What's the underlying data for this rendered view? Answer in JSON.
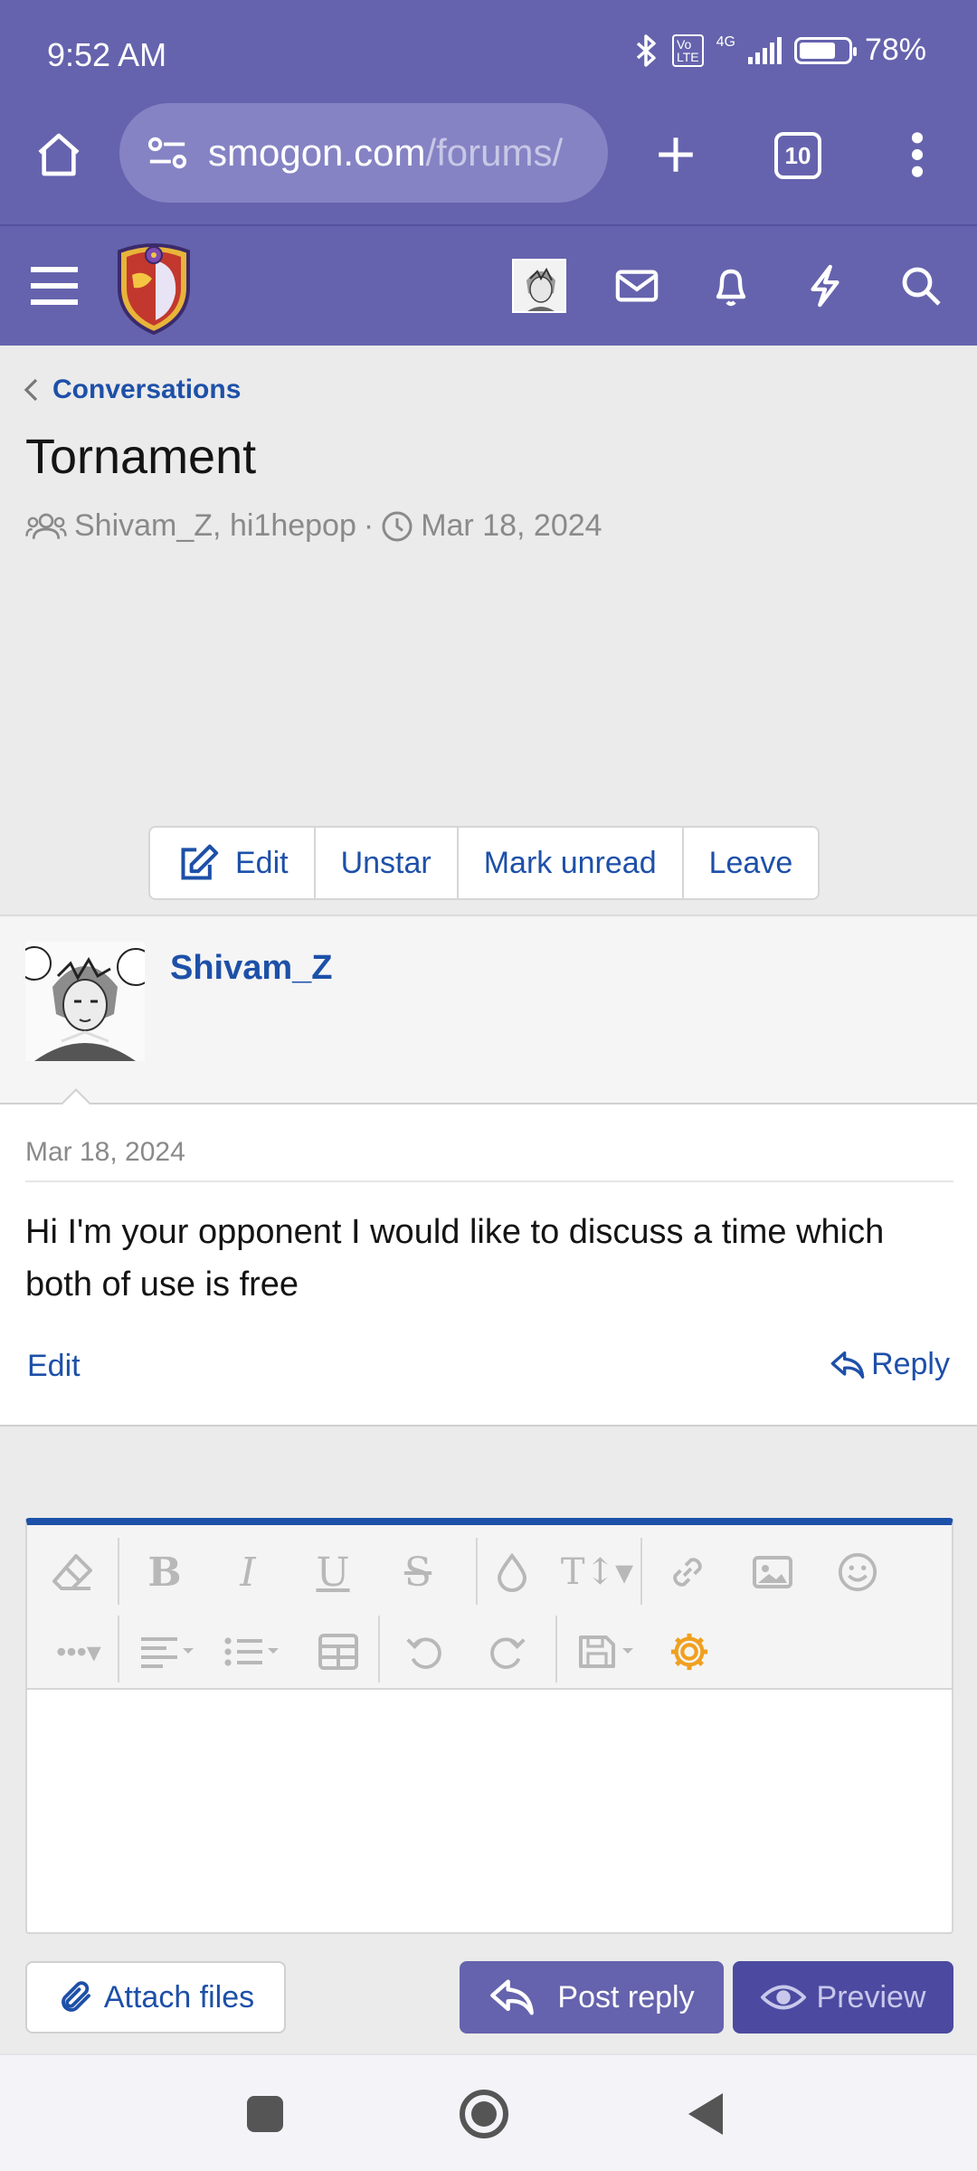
{
  "status_bar": {
    "time": "9:52 AM",
    "network_badge": "VoLTE",
    "network_type": "4G",
    "battery_percent": "78%",
    "battery_level": 0.78
  },
  "browser": {
    "url_domain": "smogon.com",
    "url_path": "/forums/",
    "tab_count": "10"
  },
  "breadcrumb": {
    "label": "Conversations"
  },
  "conversation": {
    "title": "Tornament",
    "participants": "Shivam_Z, hi1hepop",
    "separator": "·",
    "date": "Mar 18, 2024"
  },
  "actions": {
    "edit": "Edit",
    "unstar": "Unstar",
    "mark_unread": "Mark unread",
    "leave": "Leave"
  },
  "message": {
    "author": "Shivam_Z",
    "date": "Mar 18, 2024",
    "text": "Hi I'm your opponent I would like to discuss a time which both of use is free",
    "edit_label": "Edit",
    "reply_label": "Reply"
  },
  "editor": {
    "toolbar_icons": [
      "eraser-icon",
      "bold-icon",
      "italic-icon",
      "underline-icon",
      "strikethrough-icon",
      "color-icon",
      "font-size-icon",
      "link-icon",
      "image-icon",
      "emoji-icon",
      "more-icon",
      "align-icon",
      "list-icon",
      "table-icon",
      "undo-icon",
      "redo-icon",
      "drafts-icon",
      "settings-icon"
    ],
    "accent_color": "#1d50a8",
    "settings_color": "#f0a020"
  },
  "bottom_buttons": {
    "attach": "Attach files",
    "post_reply": "Post reply",
    "preview": "Preview"
  },
  "theme": {
    "header_color": "#6563ad",
    "link_color": "#1d50a8"
  }
}
